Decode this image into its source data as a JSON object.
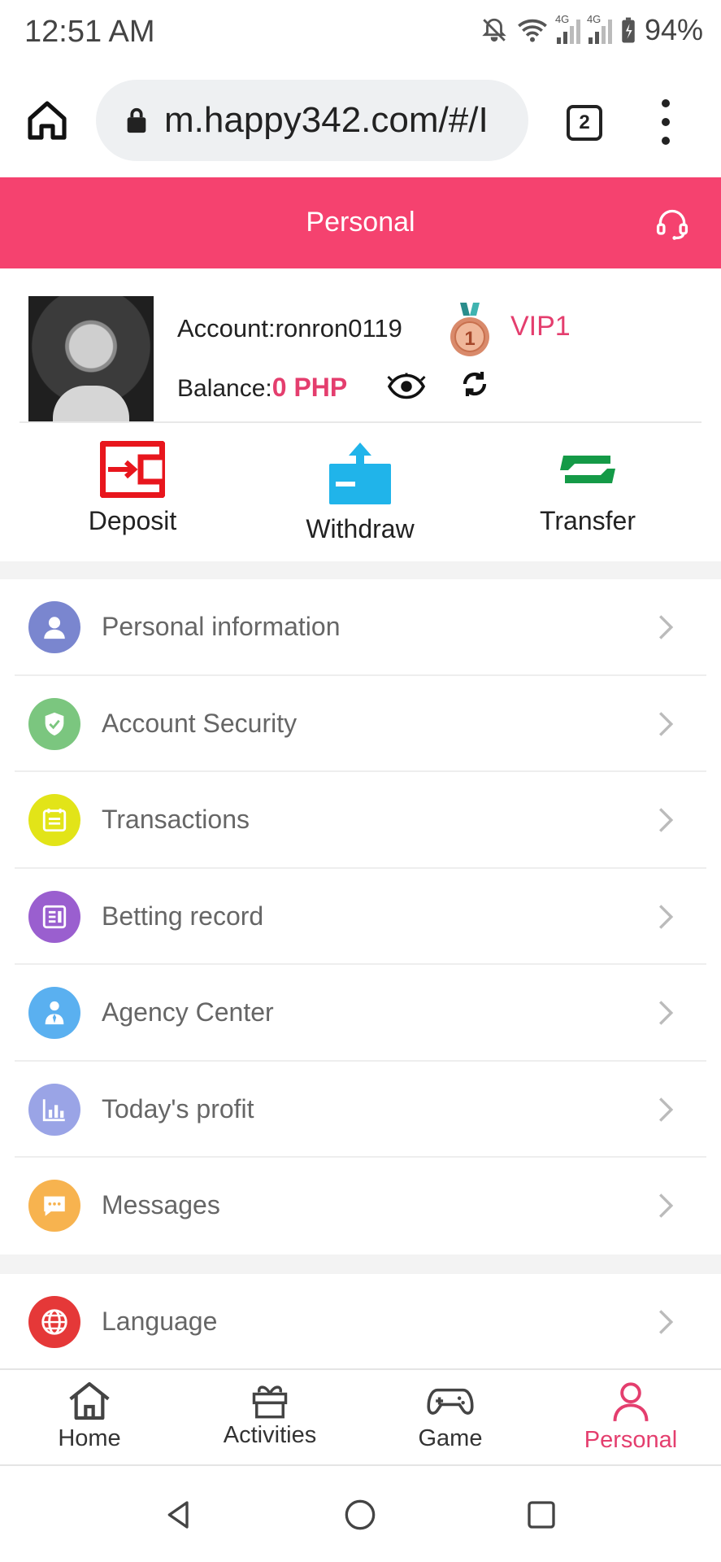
{
  "status_bar": {
    "time": "12:51 AM",
    "battery": "94%",
    "network_tag_1": "4G",
    "network_tag_2": "4G"
  },
  "browser": {
    "url": "m.happy342.com/#/I",
    "tab_count": "2"
  },
  "header": {
    "title": "Personal"
  },
  "profile": {
    "account_label": "Account:ronron0119",
    "vip_label": "VIP1",
    "medal_number": "1",
    "balance_label": "Balance:",
    "balance_value": "0 PHP"
  },
  "actions": [
    {
      "label": "Deposit",
      "color": "#e8161d"
    },
    {
      "label": "Withdraw",
      "color": "#20b4ea"
    },
    {
      "label": "Transfer",
      "color": "#149a47"
    }
  ],
  "menu": [
    {
      "label": "Personal information",
      "icon": "user-icon",
      "color": "#7a86cf"
    },
    {
      "label": "Account Security",
      "icon": "shield-icon",
      "color": "#7bc67f"
    },
    {
      "label": "Transactions",
      "icon": "calendar-icon",
      "color": "#e2e418"
    },
    {
      "label": "Betting record",
      "icon": "document-icon",
      "color": "#9a5fcf"
    },
    {
      "label": "Agency Center",
      "icon": "agent-icon",
      "color": "#5ab0f0"
    },
    {
      "label": "Today's profit",
      "icon": "bar-chart-icon",
      "color": "#9aa4e6"
    },
    {
      "label": "Messages",
      "icon": "message-icon",
      "color": "#f7b34f"
    }
  ],
  "language": {
    "label": "Language",
    "icon": "globe-icon",
    "color": "#e53838"
  },
  "tabbar": [
    {
      "label": "Home",
      "icon": "home-icon",
      "active": false
    },
    {
      "label": "Activities",
      "icon": "gift-icon",
      "active": false
    },
    {
      "label": "Game",
      "icon": "gamepad-icon",
      "active": false
    },
    {
      "label": "Personal",
      "icon": "person-icon",
      "active": true
    }
  ],
  "colors": {
    "brand": "#f5426f",
    "accent_text": "#e43e6e"
  }
}
